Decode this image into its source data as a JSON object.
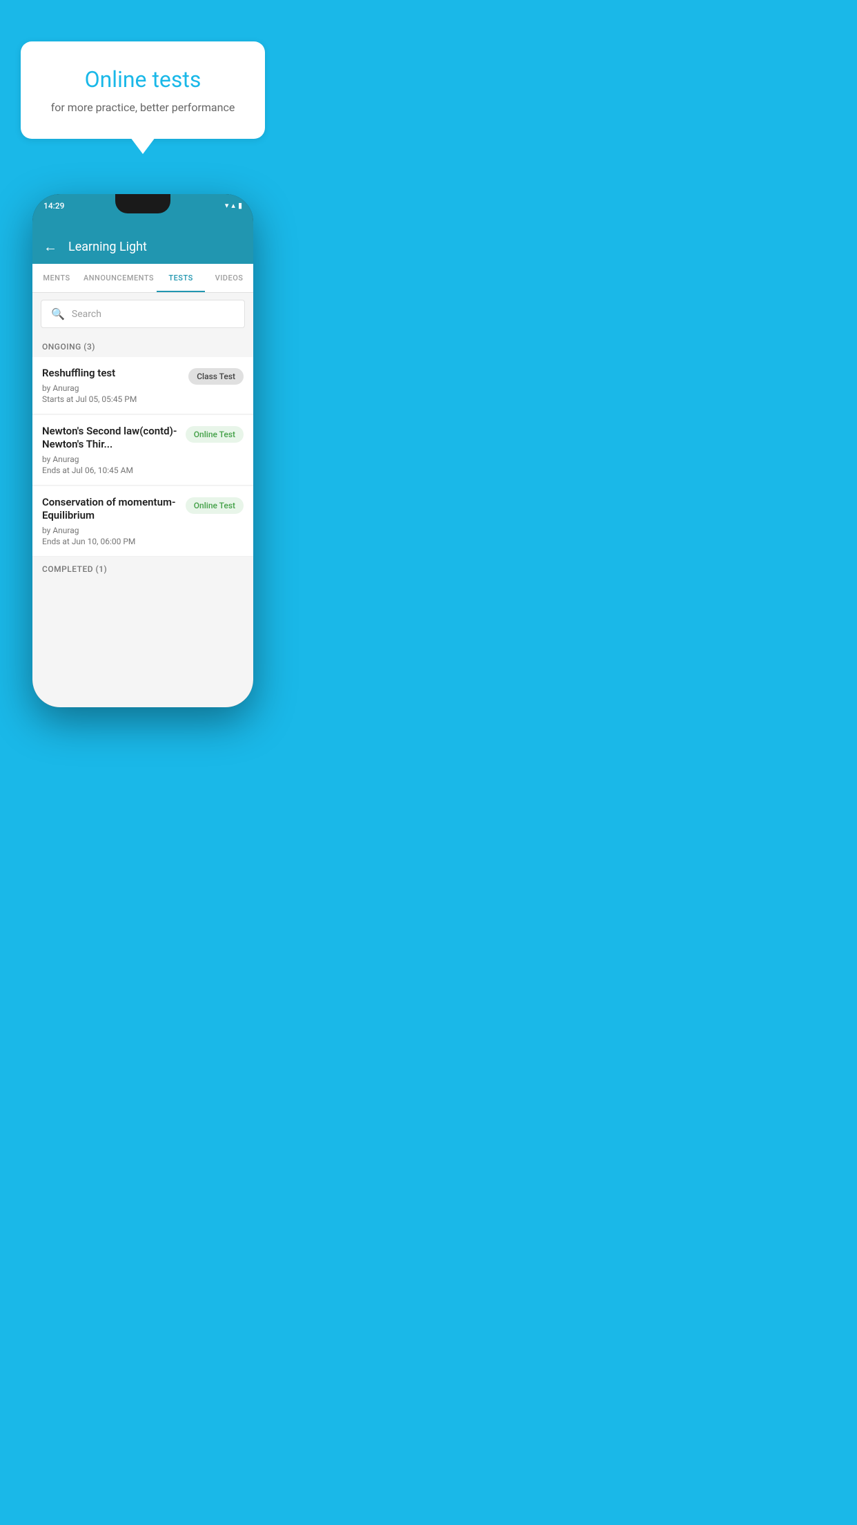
{
  "hero": {
    "bubble_title": "Online tests",
    "bubble_subtitle": "for more practice, better performance"
  },
  "status_bar": {
    "time": "14:29",
    "wifi_icon": "▼",
    "signal_icon": "▲",
    "battery_icon": "▮"
  },
  "header": {
    "back_label": "←",
    "title": "Learning Light"
  },
  "tabs": [
    {
      "label": "MENTS",
      "active": false
    },
    {
      "label": "ANNOUNCEMENTS",
      "active": false
    },
    {
      "label": "TESTS",
      "active": true
    },
    {
      "label": "VIDEOS",
      "active": false
    }
  ],
  "search": {
    "placeholder": "Search"
  },
  "ongoing_section": {
    "label": "ONGOING (3)"
  },
  "tests": [
    {
      "name": "Reshuffling test",
      "author": "by Anurag",
      "time_label": "Starts at  Jul 05, 05:45 PM",
      "badge": "Class Test",
      "badge_type": "class"
    },
    {
      "name": "Newton's Second law(contd)-Newton's Thir...",
      "author": "by Anurag",
      "time_label": "Ends at  Jul 06, 10:45 AM",
      "badge": "Online Test",
      "badge_type": "online"
    },
    {
      "name": "Conservation of momentum-Equilibrium",
      "author": "by Anurag",
      "time_label": "Ends at  Jun 10, 06:00 PM",
      "badge": "Online Test",
      "badge_type": "online"
    }
  ],
  "completed_section": {
    "label": "COMPLETED (1)"
  },
  "colors": {
    "app_blue": "#2196b0",
    "bg_blue": "#1ab8e8",
    "online_badge_bg": "#e8f5e9",
    "online_badge_text": "#43a047",
    "class_badge_bg": "#e0e0e0",
    "class_badge_text": "#424242"
  }
}
